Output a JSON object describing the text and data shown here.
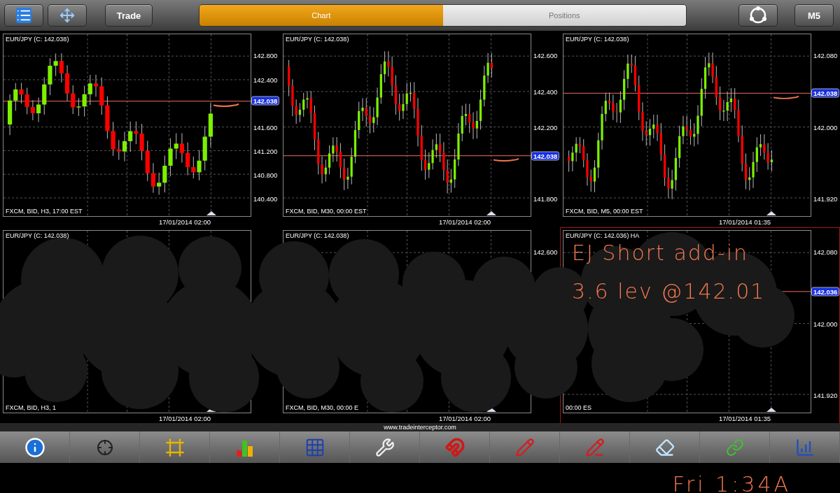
{
  "top_bar": {
    "trade_button": "Trade",
    "tabs": [
      {
        "label": "Chart",
        "selected": true
      },
      {
        "label": "Positions",
        "selected": false
      }
    ],
    "timeframe_button": "M5"
  },
  "panels": [
    {
      "header": "EUR/JPY (C: 142.038)",
      "footer": "FXCM, BID, H3, 17:00 EST",
      "date": "17/01/2014 02:00",
      "axis_labels": [
        "142.800",
        "142.400",
        "141.600",
        "141.200",
        "140.800",
        "140.400"
      ],
      "price": "142.038",
      "selected": false,
      "show_candles": true,
      "ink_mark": true
    },
    {
      "header": "EUR/JPY (C: 142.038)",
      "footer": "FXCM, BID, M30, 00:00 EST",
      "date": "17/01/2014 02:00",
      "axis_labels": [
        "142.600",
        "142.400",
        "142.200",
        "141.800"
      ],
      "price": "142.038",
      "selected": false,
      "show_candles": true,
      "ink_mark": true
    },
    {
      "header": "EUR/JPY (C: 142.038)",
      "footer": "FXCM, BID, M5, 00:00 EST",
      "date": "17/01/2014 01:35",
      "axis_labels": [
        "142.080",
        "142.000",
        "141.920"
      ],
      "price": "142.038",
      "selected": false,
      "show_candles": true,
      "ink_mark": true
    },
    {
      "header": "EUR/JPY (C: 142.038)",
      "footer": "FXCM, BID, H3, 1",
      "date": "17/01/2014 02:00",
      "selected": false,
      "show_candles": false
    },
    {
      "header": "EUR/JPY (C: 142.038)",
      "footer": "FXCM, BID, M30, 00:00 E",
      "date": "17/01/2014 02:00",
      "axis_labels": [
        "142.600"
      ],
      "selected": false,
      "show_candles": false
    },
    {
      "header": "EUR/JPY (C: 142.036) HA",
      "footer": "00:00 ES",
      "date": "17/01/2014 01:35",
      "axis_labels": [
        "142.080",
        "142.000",
        "141.920"
      ],
      "price": "142.036",
      "selected": true,
      "show_candles": false,
      "notes": [
        "EJ Short add-in",
        "3.6 lev @142.01"
      ]
    }
  ],
  "site_url": "www.tradeinterceptor.com",
  "handwritten_time": "Fri 1:34A"
}
